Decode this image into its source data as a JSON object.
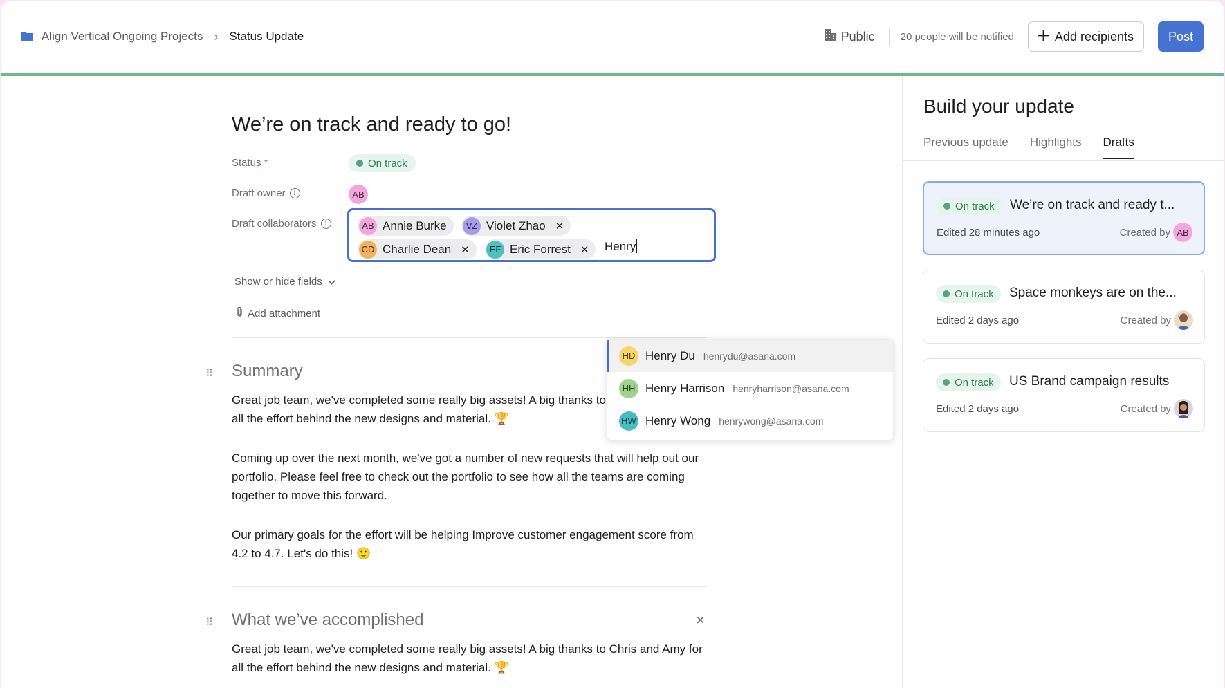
{
  "breadcrumb": {
    "project": "Align Vertical Ongoing Projects",
    "separator": "›",
    "current": "Status Update"
  },
  "header": {
    "visibility_label": "Public",
    "notify_text": "20 people will be notified",
    "add_recipients_label": "Add recipients",
    "post_label": "Post"
  },
  "update": {
    "title": "We’re on track and ready to go!",
    "status_label": "Status",
    "required_mark": "*",
    "status_value": "On track",
    "draft_owner_label": "Draft owner",
    "draft_owner_initials": "AB",
    "draft_collaborators_label": "Draft collaborators",
    "collaborators": [
      {
        "initials": "AB",
        "name": "Annie Burke"
      },
      {
        "initials": "VZ",
        "name": "Violet Zhao"
      },
      {
        "initials": "CD",
        "name": "Charlie Dean"
      },
      {
        "initials": "EF",
        "name": "Eric Forrest"
      }
    ],
    "typed_query": "Henry",
    "show_hide_fields": "Show or hide fields",
    "add_attachment": "Add attachment"
  },
  "suggestions": [
    {
      "initials": "HD",
      "name": "Henry Du",
      "email": "henrydu@asana.com"
    },
    {
      "initials": "HH",
      "name": "Henry Harrison",
      "email": "henryharrison@asana.com"
    },
    {
      "initials": "HW",
      "name": "Henry Wong",
      "email": "henrywong@asana.com"
    }
  ],
  "sections": {
    "summary": {
      "title": "Summary",
      "p1": "Great job team, we've completed some really big assets! A big thanks to Chris and Amy for all the effort behind the new designs and material. 🏆",
      "p2": "Coming up over the next month, we've got a number of new requests that will help out our portfolio. Please feel free to check out the portfolio to see how all the teams are coming together to move this forward.",
      "p3": "Our primary goals for the effort will be helping Improve customer engagement score from 4.2 to 4.7. Let's do this! 🙂"
    },
    "accomplished": {
      "title": "What we’ve accomplished",
      "p1": "Great job team, we've completed some really big assets! A big thanks to Chris and Amy for all the effort behind the new designs and material. 🏆"
    }
  },
  "panel": {
    "title": "Build your update",
    "tabs": [
      "Previous update",
      "Highlights",
      "Drafts"
    ],
    "active_tab": "Drafts",
    "drafts": [
      {
        "status": "On track",
        "title": "We’re on track and ready t...",
        "edited": "Edited 28 minutes ago",
        "created_by": "Created by",
        "owner_initials": "AB"
      },
      {
        "status": "On track",
        "title": "Space monkeys are on the...",
        "edited": "Edited 2 days ago",
        "created_by": "Created by"
      },
      {
        "status": "On track",
        "title": "US Brand campaign results",
        "edited": "Edited 2 days ago",
        "created_by": "Created by"
      }
    ]
  },
  "colors": {
    "accent_blue": "#4573d2",
    "status_green": "#58a182",
    "header_rule": "#6ab88f"
  }
}
